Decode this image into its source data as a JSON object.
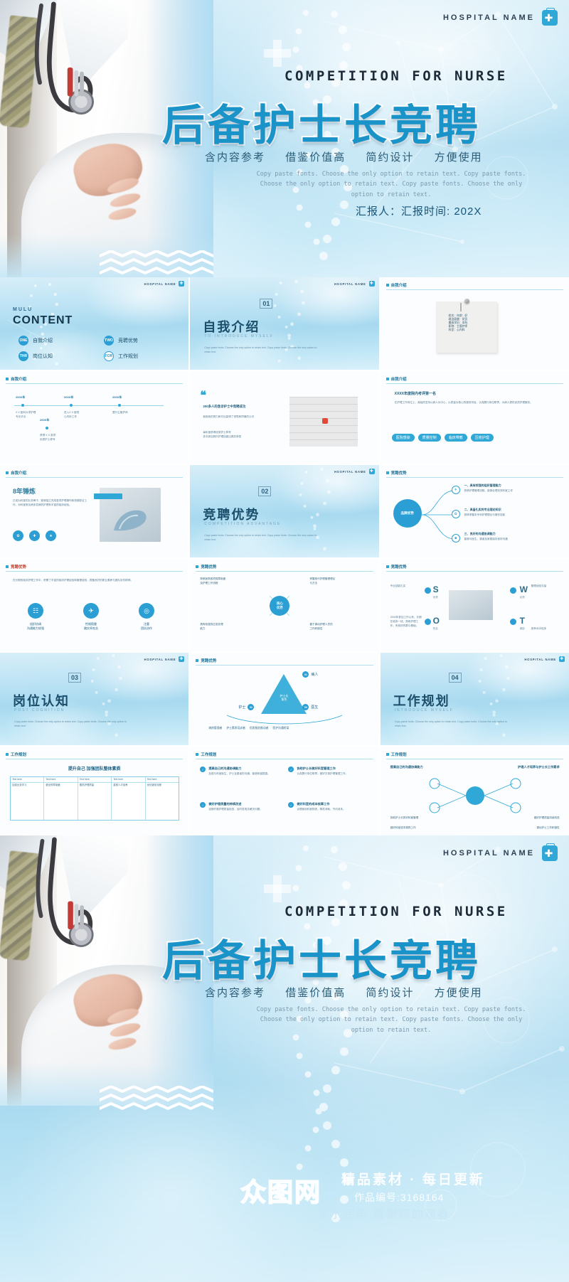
{
  "hero": {
    "brand": "HOSPITAL   NAME",
    "brand_icon": "medical-briefcase-icon",
    "en_title": "COMPETITION FOR NURSE",
    "cn_title": "后备护士长竞聘",
    "sub_items": [
      "含内容参考",
      "借鉴价值高",
      "简约设计",
      "方便使用"
    ],
    "lorem": "Copy paste fonts. Choose the only option to retain text. Copy paste fonts. Choose the only option to retain text. Copy paste fonts. Choose the only option to retain text.",
    "reporter": "汇报人：汇报时间: 202X"
  },
  "watermark": {
    "logo": "众图网",
    "slogan": "精品素材 · 每日更新",
    "code": "作品编号:3168164",
    "thanks": "演示完毕  感谢您的观看"
  },
  "accent": "#2fa8d8",
  "slides": [
    {
      "id": "content-slide",
      "kind": "content",
      "header": "HOSPITAL  NAME",
      "label_en": "MULU",
      "label_cn": "CONTENT",
      "items": [
        {
          "num": "ONE",
          "text": "自我介绍"
        },
        {
          "num": "TWO",
          "text": "竞聘优势"
        },
        {
          "num": "THR",
          "text": "岗位认知"
        },
        {
          "num": "FOR",
          "text": "工作规划"
        }
      ]
    },
    {
      "id": "section-01",
      "kind": "section",
      "header": "HOSPITAL  NAME",
      "number": "01",
      "title_cn": "自我介绍",
      "title_en": "TO INTRODUCE MYSELF",
      "body": "Copy paste fonts. Choose the only option to retain text. Copy paste fonts. Choose the only option to retain text."
    },
    {
      "id": "intro-note",
      "kind": "white",
      "tag": "自我介绍",
      "note_lines": [
        "姓名：年龄：好",
        "政治面貌：党员",
        "最高学历：本科",
        "职称：主管护师",
        "科室：心内科"
      ]
    },
    {
      "id": "intro-timeline",
      "kind": "white",
      "tag": "自我介绍",
      "timeline": [
        {
          "year": "200X年",
          "text": "X X 医科大学护理\n专业毕业"
        },
        {
          "year": "200X年",
          "text": "进入X X 医院\n心内科工作"
        },
        {
          "year": "200X年",
          "text": "晋升主管护师"
        },
        {
          "year": "200X年",
          "text": "获得 X X 奖项\n优秀护士称号"
        }
      ]
    },
    {
      "id": "intro-quote",
      "kind": "white",
      "tag": "",
      "quote_title": "200多人的急诊护士中竞聘成功",
      "quote_body": "我用我的努力和付出赢得了领导和同事的认可",
      "quote_note": "每年度获得优秀护士称号\n多次参加院内护理技能比赛并获奖"
    },
    {
      "id": "intro-awards",
      "kind": "white",
      "tag": "自我介绍",
      "award_title": "XXXX年度院内考评第一名",
      "award_body": "在护理工作岗位上，我始终坚持以病人为中心，以质量为核心的服务宗旨，认真履行岗位职责，为病人提供优质护理服务。",
      "chips": [
        "医院感染",
        "质量控制",
        "临床带教",
        "压疮护理"
      ]
    },
    {
      "id": "intro-years",
      "kind": "white",
      "tag": "自我介绍",
      "big": "8年锤炼",
      "body": "已成为科室的业务骨干，能够独立完成各项护理操作和抢救配合工作，对科室常见病多发病的护理有丰富的临床经验。",
      "icons": [
        "circle-a",
        "circle-b",
        "circle-c"
      ]
    },
    {
      "id": "section-02",
      "kind": "section",
      "header": "HOSPITAL  NAME",
      "number": "02",
      "title_cn": "竞聘优势",
      "title_en": "COMPETITION ADVANTAGE",
      "body": "Copy paste fonts. Choose the only option to retain text. Copy paste fonts. Choose the only option to retain text."
    },
    {
      "id": "adv-radial",
      "kind": "white",
      "tag": "竞聘优势",
      "center": "品牌优势",
      "branches": [
        {
          "title": "一、具有较强的组织管理能力",
          "text": "熟悉护理管理流程，能够合理安排科室工作"
        },
        {
          "title": "二、具备扎实的专业理论知识",
          "text": "熟练掌握本专科护理理论与操作技能"
        },
        {
          "title": "三、良好的沟通协调能力",
          "text": "能够与医生、患者及家属保持良好沟通"
        }
      ]
    },
    {
      "id": "adv-three",
      "kind": "white",
      "tag": "竞聘优势",
      "body": "在长期的临床护理工作中，积累了丰富的临床护理经验和管理经验，具备良好的职业素养与团队协作精神。",
      "cards": [
        {
          "title": "组织协调\n沟通能力较强",
          "icon": "people-icon"
        },
        {
          "title": "性格稳重\n踏实肯吃苦",
          "icon": "plane-icon"
        },
        {
          "title": "注重\n团队协作",
          "icon": "compass-icon"
        }
      ]
    },
    {
      "id": "adv-center",
      "kind": "white",
      "tag": "竞聘优势",
      "center_label": "核心\n优势",
      "quads": [
        "熟悉医院各项规章制度\n及护理工作流程",
        "掌握现代护理管理理论\n与方法",
        "具有较强的应急处理\n能力",
        "善于调动护理人员的\n工作积极性"
      ]
    },
    {
      "id": "adv-swot",
      "kind": "white",
      "tag": "竞聘优势",
      "swot": [
        {
          "letter": "S",
          "cn": "优势",
          "text": "专业技能扎实"
        },
        {
          "letter": "W",
          "cn": "劣势",
          "text": "管理经验欠缺"
        },
        {
          "letter": "O",
          "cn": "机会",
          "text": "医院发展良好"
        },
        {
          "letter": "T",
          "cn": "威胁",
          "text": "竞争对手较多"
        }
      ],
      "note": "2000年参加工作以来，长期在临床一线，熟悉护理工作，有良好的群众基础。"
    },
    {
      "id": "section-03",
      "kind": "section",
      "header": "HOSPITAL  NAME",
      "number": "03",
      "title_cn": "岗位认知",
      "title_en": "POST COGNITION",
      "body": "Copy paste fonts. Choose the only option to retain text. Copy paste fonts. Choose the only option to retain text."
    },
    {
      "id": "post-triangle",
      "kind": "white",
      "tag": "竞聘优势",
      "tri_center": "护士长\n角色",
      "tri_nodes": [
        {
          "num": "01",
          "label": "病人"
        },
        {
          "num": "02",
          "label": "护士"
        },
        {
          "num": "03",
          "label": "医生"
        }
      ],
      "bottom": [
        "病房管理者",
        "护士素质培训者",
        "优质服务推动者",
        "医护沟通桥梁"
      ]
    },
    {
      "id": "section-04",
      "kind": "section",
      "header": "HOSPITAL  NAME",
      "number": "04",
      "title_cn": "工作规划",
      "title_en": "INTRODUCE MYSELF",
      "body": "Copy paste fonts. Choose the only option to retain text. Copy paste fonts. Choose the only option to retain text."
    },
    {
      "id": "plan-table",
      "kind": "white",
      "tag": "工作规划",
      "title": "提升自己 加强团队整体素质",
      "columns": [
        "Text here",
        "Text here",
        "Text here",
        "Text here",
        "Text here"
      ],
      "cells": [
        "加强业务学习",
        "健全规章制度",
        "狠抓护理质量",
        "重视人才培养",
        "优化服务流程"
      ]
    },
    {
      "id": "plan-list",
      "kind": "white",
      "tag": "工作规划",
      "items": [
        {
          "title": "提高自己的沟通协调能力",
          "text": "加强与科室医生、护士及患者的沟通，营造和谐氛围。"
        },
        {
          "title": "协助护士长做好科室管理工作",
          "text": "认真履行岗位职责，做好日常护理管理工作。"
        },
        {
          "title": "做好护理质量的持续改进",
          "text": "定期开展护理质量检查，及时发现并解决问题。"
        },
        {
          "title": "做好科室的成本核算工作",
          "text": "合理使用科室物资，降低消耗，节约成本。"
        }
      ]
    },
    {
      "id": "plan-radial",
      "kind": "white",
      "tag": "工作规划",
      "left_title": "提高自己的沟通协调能力",
      "right_title": "护理人才培养与护士长工作要求",
      "nodes": [
        "协助护士长抓好科室管理",
        "做好护理质量持续改进",
        "做好科室成本核算工作",
        "调动护士工作积极性"
      ]
    }
  ]
}
